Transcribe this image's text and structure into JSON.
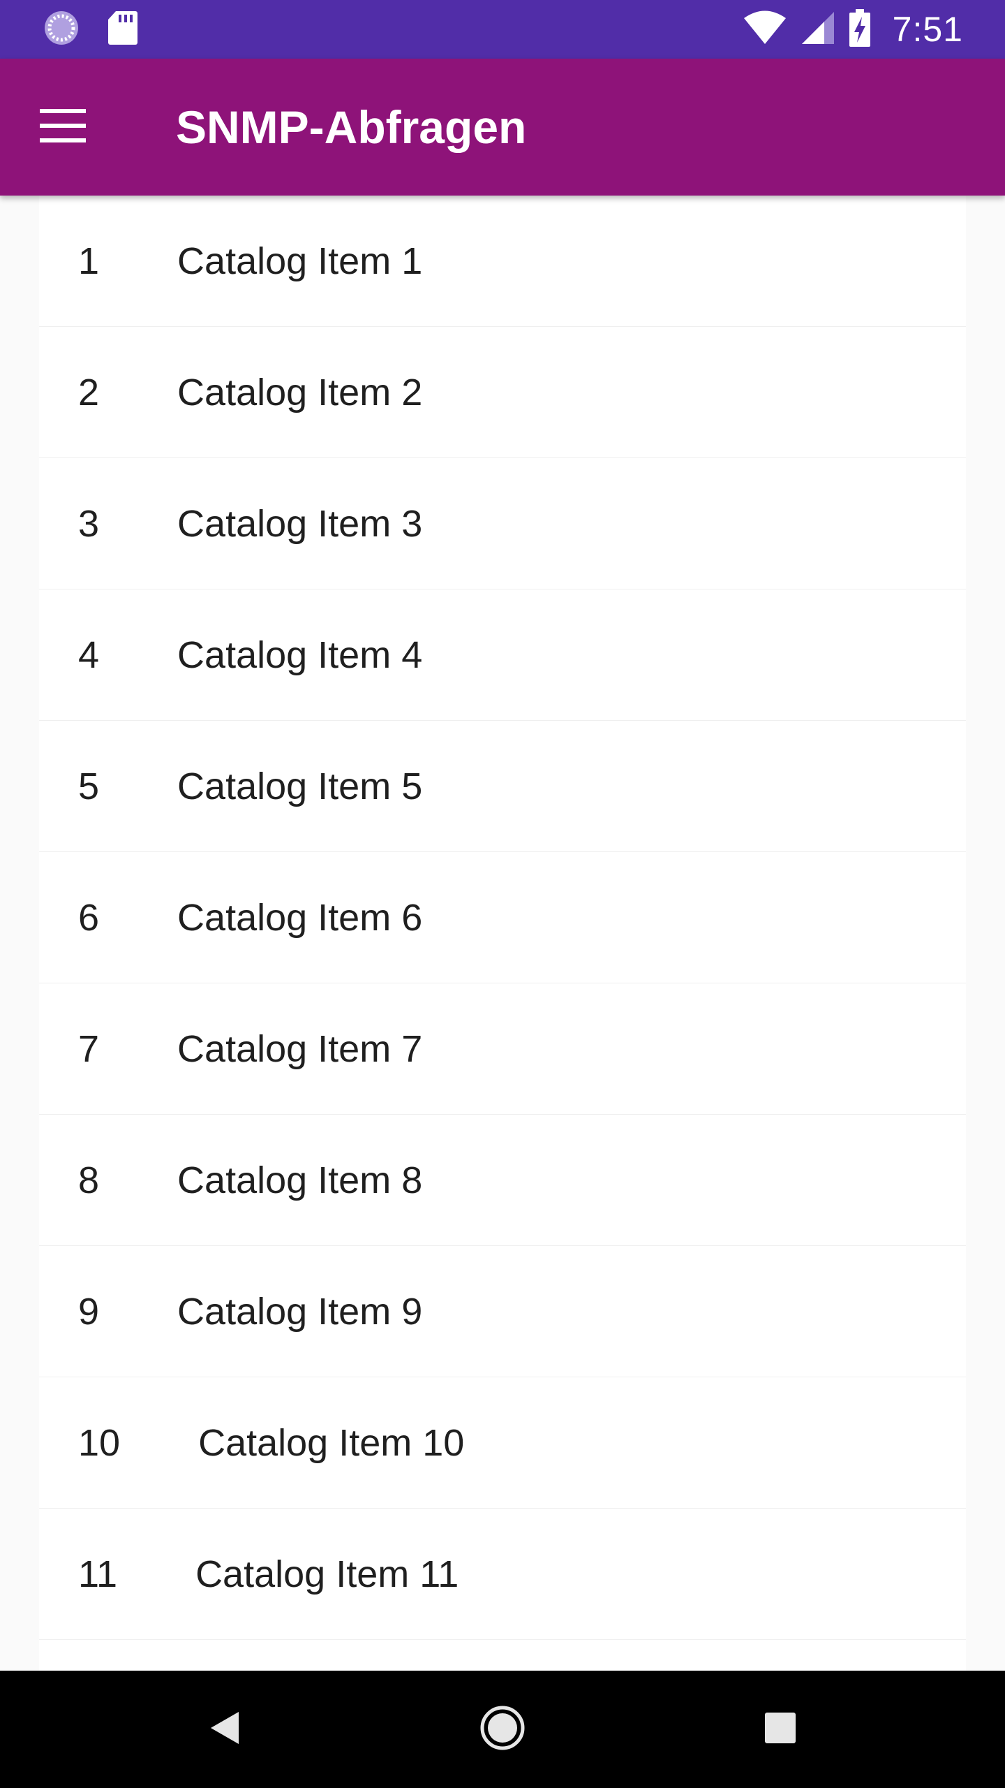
{
  "status_bar": {
    "time": "7:51",
    "background": "#512da8",
    "icons": [
      "sync-icon",
      "sd-card-icon",
      "wifi-icon",
      "cell-signal-icon",
      "battery-charging-icon"
    ]
  },
  "app_bar": {
    "title": "SNMP-Abfragen",
    "background": "#8e1379",
    "menu_icon": "hamburger-menu-icon"
  },
  "list": {
    "items": [
      {
        "number": "1",
        "label": "Catalog Item 1"
      },
      {
        "number": "2",
        "label": "Catalog Item 2"
      },
      {
        "number": "3",
        "label": "Catalog Item 3"
      },
      {
        "number": "4",
        "label": "Catalog Item 4"
      },
      {
        "number": "5",
        "label": "Catalog Item 5"
      },
      {
        "number": "6",
        "label": "Catalog Item 6"
      },
      {
        "number": "7",
        "label": "Catalog Item 7"
      },
      {
        "number": "8",
        "label": "Catalog Item 8"
      },
      {
        "number": "9",
        "label": "Catalog Item 9"
      },
      {
        "number": "10",
        "label": "Catalog Item 10"
      },
      {
        "number": "11",
        "label": "Catalog Item 11"
      }
    ]
  },
  "nav_bar": {
    "icons": [
      "back-icon",
      "home-icon",
      "recents-icon"
    ]
  }
}
